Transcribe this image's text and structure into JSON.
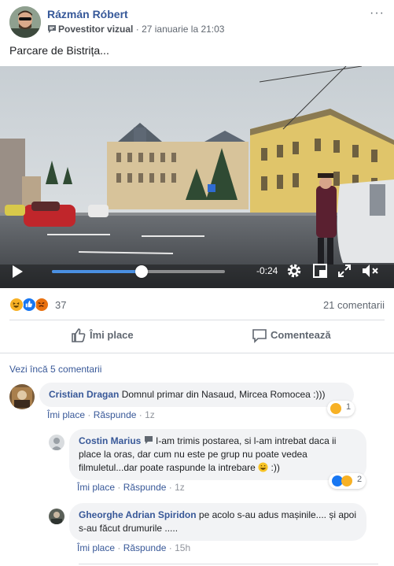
{
  "post": {
    "author": "Rázmán Róbert",
    "badge": "Povestitor vizual",
    "timestamp": "27 ianuarie la 21:03",
    "text": "Parcare de Bistrița...",
    "more_label": "···"
  },
  "video": {
    "time_remaining": "-0:24",
    "progress_percent": 52
  },
  "reactions": {
    "types": [
      "haha",
      "like",
      "angry"
    ],
    "count": "37",
    "comments_count": "21 comentarii"
  },
  "actions": {
    "like_label": "Îmi place",
    "comment_label": "Comentează"
  },
  "comments_section": {
    "more_comments": "Vezi încă 5 comentarii"
  },
  "comments": [
    {
      "author": "Cristian Dragan",
      "text": "Domnul primar din Nasaud, Mircea Romocea :)))",
      "like_label": "Îmi place",
      "reply_label": "Răspunde",
      "time": "1z",
      "reaction_count": "1"
    },
    {
      "author": "Costin Marius",
      "text": "I-am trimis postarea, si l-am intrebat daca ii place la oras, dar cum nu este pe grup nu poate vedea filmuletul...dar poate raspunde la intrebare",
      "text_suffix": ":))",
      "like_label": "Îmi place",
      "reply_label": "Răspunde",
      "time": "1z",
      "reaction_count": "2"
    },
    {
      "author": "Gheorghe Adrian Spiridon",
      "text": "pe acolo s-au adus mașinile.... și apoi s-au făcut drumurile .....",
      "like_label": "Îmi place",
      "reply_label": "Răspunde",
      "time": "15h"
    }
  ],
  "colors": {
    "link": "#385898",
    "author": "#365899",
    "muted": "#606770",
    "bubble": "#f2f3f5",
    "like_blue": "#1877f2",
    "angry_orange": "#e9710f",
    "haha_yellow": "#f7b125",
    "progress": "#4a90e2"
  }
}
